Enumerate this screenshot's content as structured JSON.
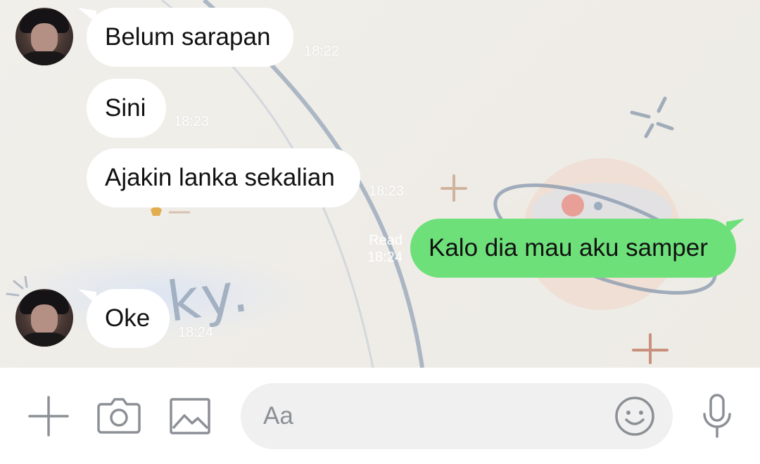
{
  "messages": [
    {
      "direction": "in",
      "text": "Belum sarapan",
      "time": "18:22",
      "avatar": true
    },
    {
      "direction": "in",
      "text": "Sini",
      "time": "18:23",
      "avatar": false
    },
    {
      "direction": "in",
      "text": "Ajakin lanka sekalian",
      "time": "18:23",
      "avatar": false
    },
    {
      "direction": "out",
      "text": "Kalo dia mau aku samper",
      "time": "18:24",
      "status": "Read"
    },
    {
      "direction": "in",
      "text": "Oke",
      "time": "18:24",
      "avatar": true
    }
  ],
  "wallpaper": {
    "text": "ky."
  },
  "input": {
    "placeholder": "Aa"
  },
  "toolbar": {
    "icons": [
      "plus-icon",
      "camera-icon",
      "image-icon",
      "smiley-icon",
      "microphone-icon"
    ]
  },
  "colors": {
    "outgoing_bubble": "#6ee07a",
    "incoming_bubble": "#ffffff",
    "input_field": "#f0f0f0",
    "icon_gray": "#8c9096"
  }
}
